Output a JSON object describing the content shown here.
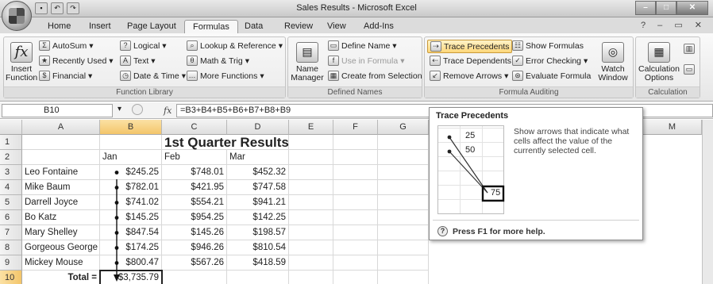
{
  "window": {
    "title": "Sales Results - Microsoft Excel"
  },
  "tabs": [
    "Home",
    "Insert",
    "Page Layout",
    "Formulas",
    "Data",
    "Review",
    "View",
    "Add-Ins"
  ],
  "ribbon": {
    "function_library": {
      "label": "Function Library",
      "insert_function": "Insert Function",
      "autosum": "AutoSum",
      "recently_used": "Recently Used",
      "financial": "Financial",
      "logical": "Logical",
      "text": "Text",
      "date_time": "Date & Time",
      "lookup_reference": "Lookup & Reference",
      "math_trig": "Math & Trig",
      "more_functions": "More Functions"
    },
    "defined_names": {
      "label": "Defined Names",
      "name_manager": "Name Manager",
      "define_name": "Define Name",
      "use_in_formula": "Use in Formula",
      "create_from_selection": "Create from Selection"
    },
    "formula_auditing": {
      "label": "Formula Auditing",
      "trace_precedents": "Trace Precedents",
      "trace_dependents": "Trace Dependents",
      "remove_arrows": "Remove Arrows",
      "show_formulas": "Show Formulas",
      "error_checking": "Error Checking",
      "evaluate_formula": "Evaluate Formula",
      "watch_window": "Watch Window"
    },
    "calculation": {
      "label": "Calculation",
      "calculation_options": "Calculation Options"
    }
  },
  "formula_bar": {
    "name_box": "B10",
    "fx": "fx",
    "formula": "=B3+B4+B5+B6+B7+B8+B9"
  },
  "columns": [
    "A",
    "B",
    "C",
    "D",
    "E",
    "F",
    "G",
    "M"
  ],
  "rows": [
    {
      "n": "1",
      "A": "",
      "B": "",
      "C": "1st Quarter Results",
      "D": ""
    },
    {
      "n": "2",
      "A": "",
      "B": "Jan",
      "C": "Feb",
      "D": "Mar"
    },
    {
      "n": "3",
      "A": "Leo Fontaine",
      "B": "$245.25",
      "C": "$748.01",
      "D": "$452.32"
    },
    {
      "n": "4",
      "A": "Mike Baum",
      "B": "$782.01",
      "C": "$421.95",
      "D": "$747.58"
    },
    {
      "n": "5",
      "A": "Darrell Joyce",
      "B": "$741.02",
      "C": "$554.21",
      "D": "$941.21"
    },
    {
      "n": "6",
      "A": "Bo Katz",
      "B": "$145.25",
      "C": "$954.25",
      "D": "$142.25"
    },
    {
      "n": "7",
      "A": "Mary Shelley",
      "B": "$847.54",
      "C": "$145.26",
      "D": "$198.57"
    },
    {
      "n": "8",
      "A": "Gorgeous George",
      "B": "$174.25",
      "C": "$946.26",
      "D": "$810.54"
    },
    {
      "n": "9",
      "A": "Mickey Mouse",
      "B": "$800.47",
      "C": "$567.26",
      "D": "$418.59"
    },
    {
      "n": "10",
      "A": "Total =",
      "B": "$3,735.79",
      "C": "",
      "D": ""
    }
  ],
  "tooltip": {
    "title": "Trace Precedents",
    "description": "Show arrows that indicate what cells affect the value of the currently selected cell.",
    "pic_values": [
      "25",
      "50",
      "75"
    ],
    "help": "Press F1 for more help."
  }
}
